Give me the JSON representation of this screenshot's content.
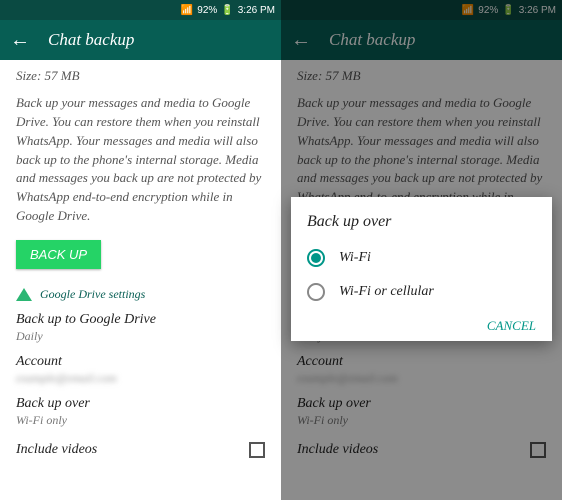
{
  "status": {
    "battery": "92%",
    "time": "3:26 PM",
    "battery_icon": "▮",
    "signal_icon": "▮▯"
  },
  "title": "Chat backup",
  "left": {
    "size_line": "Size: 57 MB",
    "description": "Back up your messages and media to Google Drive. You can restore them when you reinstall WhatsApp. Your messages and media will also back up to the phone's internal storage. Media and messages you back up are not protected by WhatsApp end-to-end encryption while in Google Drive.",
    "backup_btn": "BACK UP",
    "gd_title": "Google Drive settings",
    "opt1_label": "Back up to Google Drive",
    "opt1_value": "Daily",
    "opt2_label": "Account",
    "opt2_value": "example@email.com",
    "opt3_label": "Back up over",
    "opt3_value": "Wi-Fi only",
    "opt4_label": "Include videos"
  },
  "dialog": {
    "title": "Back up over",
    "option1": "Wi-Fi",
    "option2": "Wi-Fi or cellular",
    "cancel": "CANCEL"
  }
}
